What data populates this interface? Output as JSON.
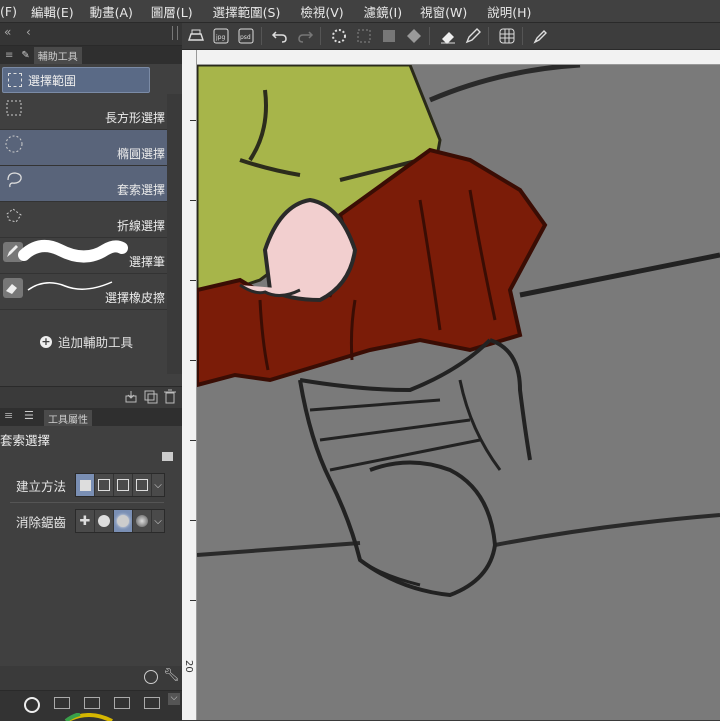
{
  "menu": [
    "(F)",
    "編輯(E)",
    "動畫(A)",
    "圖層(L)",
    "選擇範圍(S)",
    "檢視(V)",
    "濾鏡(I)",
    "視窗(W)",
    "說明(H)"
  ],
  "subtool_panel": {
    "title": "輔助工具",
    "group_tab": "選擇範圍",
    "tools": [
      {
        "label": "長方形選擇",
        "icon": "rect-select-icon",
        "selected": false
      },
      {
        "label": "橢圓選擇",
        "icon": "ellipse-select-icon",
        "selected": true
      },
      {
        "label": "套索選擇",
        "icon": "lasso-select-icon",
        "selected": true
      },
      {
        "label": "折線選擇",
        "icon": "polyline-select-icon",
        "selected": false
      },
      {
        "label": "選擇筆",
        "icon": "selection-pen-icon",
        "selected": false
      },
      {
        "label": "選擇橡皮擦",
        "icon": "selection-eraser-icon",
        "selected": false
      }
    ],
    "add_tool": "追加輔助工具"
  },
  "tool_property": {
    "title": "工具屬性",
    "tool_name": "套索選擇",
    "creation_method_label": "建立方法",
    "antialias_label": "消除鋸齒"
  },
  "ruler_mark": "20",
  "colors": {
    "accent_selected": "#59647a",
    "canvas_bg": "#7a7a7a",
    "skirt": "#7b1c08",
    "shirt": "#a7b54a",
    "skin": "#f2cfcf"
  }
}
